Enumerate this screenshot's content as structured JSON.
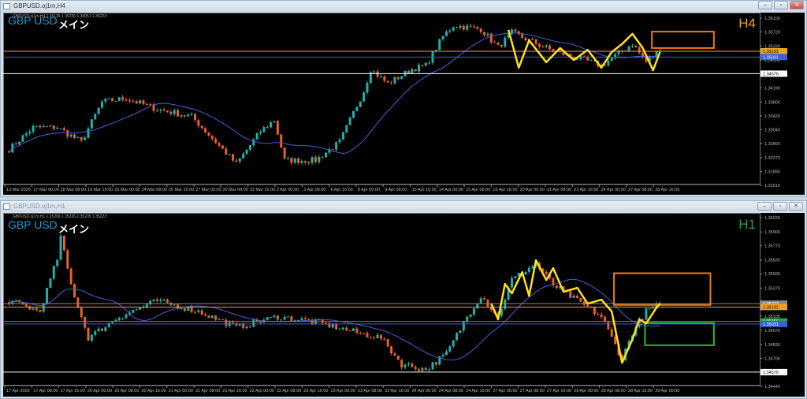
{
  "windows": [
    {
      "title": "GBPUSD.oj1m,H4",
      "info": "GBPUSD.oj1m,H4  1.35135 1.35226 1.35051 1.35223",
      "symbol": "GBP USD",
      "label": "メイン",
      "timeframe": "H4",
      "timeframe_color": "#f0a020",
      "price_ticks": [
        "1.36100",
        "1.35720",
        "1.35330",
        "1.34950",
        "1.34190",
        "1.33800",
        "1.33420",
        "1.33040",
        "1.32660",
        "1.32270",
        "1.31890",
        "1.31510"
      ],
      "price_range": [
        1.31555,
        1.36252
      ],
      "markers": [
        {
          "price": "1.35191",
          "color": "#f0a020",
          "text": "#000"
        },
        {
          "price": "1.35031",
          "color": "#3a5fd8",
          "text": "#fff"
        },
        {
          "price": "1.34576",
          "color": "#ffffff",
          "text": "#000"
        }
      ],
      "time_labels": [
        "13 Mar 2026",
        "17 Mar 00:00",
        "18 Mar 08:00",
        "19 Mar 16:00",
        "23 Mar 00:00",
        "24 Mar 08:00",
        "25 Mar 16:00",
        "27 Mar 00:00",
        "30 Mar 08:00",
        "31 Mar 16:00",
        "2 Apr 00:00",
        "3 Apr 08:00",
        "6 Apr 16:00",
        "8 Apr 00:00",
        "9 Apr 08:00",
        "10 Apr 16:00",
        "14 Apr 00:00",
        "15 Apr 08:00",
        "16 Apr 16:00",
        "20 Apr 00:00",
        "21 Apr 08:00",
        "22 Apr 16:00",
        "24 Apr 00:00",
        "27 Apr 08:00",
        "28 Apr 16:00"
      ],
      "close_anchors": [
        [
          0,
          1.325
        ],
        [
          7,
          1.331
        ],
        [
          14,
          1.331
        ],
        [
          21,
          1.327
        ],
        [
          27,
          1.338
        ],
        [
          34,
          1.339
        ],
        [
          43,
          1.336
        ],
        [
          53,
          1.334
        ],
        [
          62,
          1.325
        ],
        [
          66,
          1.321
        ],
        [
          73,
          1.33
        ],
        [
          77,
          1.333
        ],
        [
          80,
          1.322
        ],
        [
          89,
          1.322
        ],
        [
          96,
          1.327
        ],
        [
          103,
          1.341
        ],
        [
          105,
          1.347
        ],
        [
          110,
          1.343
        ],
        [
          117,
          1.347
        ],
        [
          121,
          1.348
        ],
        [
          126,
          1.356
        ],
        [
          129,
          1.359
        ],
        [
          137,
          1.358
        ],
        [
          142,
          1.353
        ],
        [
          146,
          1.357
        ],
        [
          158,
          1.352
        ],
        [
          172,
          1.348
        ],
        [
          181,
          1.354
        ],
        [
          185,
          1.349
        ],
        [
          189,
          1.3522
        ]
      ],
      "zigzag": [
        [
          145,
          1.3578
        ],
        [
          148,
          1.3474
        ],
        [
          151,
          1.3549
        ],
        [
          156,
          1.3489
        ],
        [
          160,
          1.3528
        ],
        [
          164,
          1.3495
        ],
        [
          168,
          1.3523
        ],
        [
          172,
          1.3474
        ],
        [
          175,
          1.3517
        ],
        [
          178,
          1.3539
        ],
        [
          181,
          1.3567
        ],
        [
          184,
          1.3528
        ],
        [
          187,
          1.3467
        ],
        [
          189,
          1.3517
        ]
      ],
      "boxes": [
        {
          "bars": [
            187,
            205
          ],
          "prices": [
            1.3573,
            1.3528
          ],
          "color": "#f07a10"
        }
      ]
    },
    {
      "title": "GBPUSD.oj1m,H1",
      "info": "GBPUSD.oj1m,H1  1.35206 1.35226 1.35205 1.35223",
      "symbol": "GBP USD",
      "label": "メイン",
      "timeframe": "H1",
      "timeframe_color": "#20a050",
      "price_ticks": [
        "1.36035",
        "1.35900",
        "1.35770",
        "1.35635",
        "1.35505",
        "1.35370",
        "1.35105",
        "1.34970",
        "1.34835",
        "1.34705",
        "1.34440"
      ],
      "price_range": [
        1.34456,
        1.3608
      ],
      "markers": [
        {
          "price": "1.35223",
          "color": "#8a8a8a",
          "text": "#fff"
        },
        {
          "price": "1.35191",
          "color": "#f0a020",
          "text": "#000"
        },
        {
          "price": "1.35055",
          "color": "#20b040",
          "text": "#fff"
        },
        {
          "price": "1.35031",
          "color": "#3a5fd8",
          "text": "#fff"
        },
        {
          "price": "1.34576",
          "color": "#ffffff",
          "text": "#000"
        }
      ],
      "time_labels": [
        "17 Apr 2026",
        "17 Apr 08:00",
        "17 Apr 16:00",
        "20 Apr 00:00",
        "20 Apr 08:00",
        "20 Apr 16:00",
        "21 Apr 00:00",
        "21 Apr 08:00",
        "21 Apr 16:00",
        "22 Apr 00:00",
        "22 Apr 08:00",
        "22 Apr 16:00",
        "23 Apr 00:00",
        "23 Apr 08:00",
        "23 Apr 16:00",
        "24 Apr 00:00",
        "24 Apr 08:00",
        "24 Apr 16:00",
        "27 Apr 00:00",
        "27 Apr 08:00",
        "27 Apr 16:00",
        "28 Apr 00:00",
        "28 Apr 08:00",
        "28 Apr 16:00",
        "29 Apr 00:00"
      ],
      "close_anchors": [
        [
          0,
          1.3525
        ],
        [
          9,
          1.3515
        ],
        [
          14,
          1.3565
        ],
        [
          15,
          1.3585
        ],
        [
          18,
          1.354
        ],
        [
          23,
          1.349
        ],
        [
          32,
          1.351
        ],
        [
          43,
          1.3525
        ],
        [
          55,
          1.3515
        ],
        [
          66,
          1.35
        ],
        [
          78,
          1.351
        ],
        [
          89,
          1.3505
        ],
        [
          101,
          1.3495
        ],
        [
          108,
          1.349
        ],
        [
          114,
          1.3465
        ],
        [
          121,
          1.346
        ],
        [
          127,
          1.3475
        ],
        [
          133,
          1.351
        ],
        [
          137,
          1.353
        ],
        [
          142,
          1.351
        ],
        [
          146,
          1.3545
        ],
        [
          153,
          1.356
        ],
        [
          158,
          1.354
        ],
        [
          165,
          1.3525
        ],
        [
          172,
          1.351
        ],
        [
          178,
          1.347
        ],
        [
          181,
          1.3495
        ],
        [
          185,
          1.3515
        ],
        [
          189,
          1.3522
        ]
      ],
      "zigzag": [
        [
          140,
          1.35223
        ],
        [
          142,
          1.35074
        ],
        [
          144,
          1.35409
        ],
        [
          146,
          1.3532
        ],
        [
          149,
          1.35521
        ],
        [
          151,
          1.35297
        ],
        [
          153,
          1.35633
        ],
        [
          156,
          1.35446
        ],
        [
          158,
          1.35558
        ],
        [
          161,
          1.35335
        ],
        [
          165,
          1.35372
        ],
        [
          168,
          1.35223
        ],
        [
          172,
          1.3526
        ],
        [
          175,
          1.35148
        ],
        [
          178,
          1.34664
        ],
        [
          181,
          1.34887
        ],
        [
          183,
          1.35074
        ],
        [
          185,
          1.35036
        ],
        [
          188,
          1.35186
        ],
        [
          189,
          1.35223
        ]
      ],
      "boxes": [
        {
          "bars": [
            176,
            204
          ],
          "prices": [
            1.3551,
            1.3521
          ],
          "color": "#f07a10"
        },
        {
          "bars": [
            185,
            205
          ],
          "prices": [
            1.3504,
            1.3483
          ],
          "color": "#20c030"
        }
      ]
    }
  ],
  "colors": {
    "bull": "#20b2aa",
    "bear": "#e8602a",
    "ma": "#4a5fd8",
    "zigzag": "#ffe020"
  }
}
